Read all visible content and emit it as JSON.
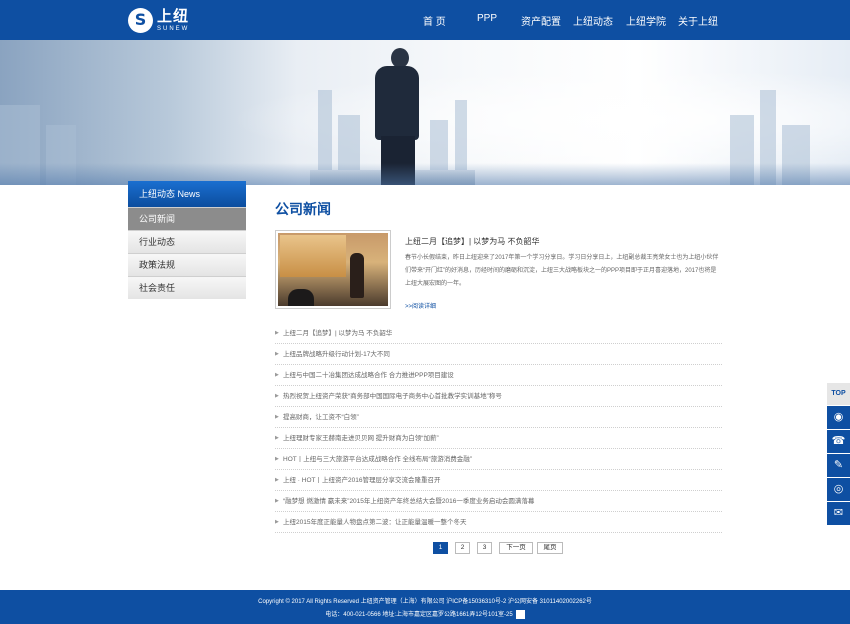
{
  "brand": {
    "name_cn": "上纽",
    "name_en": "SUNEW",
    "logo_letter": "S"
  },
  "nav": {
    "items": [
      {
        "label": "首 页"
      },
      {
        "label": "PPP"
      },
      {
        "label": "资产配置"
      },
      {
        "label": "上纽动态"
      },
      {
        "label": "上纽学院"
      },
      {
        "label": "关于上纽"
      }
    ]
  },
  "sidebar": {
    "header": "上纽动态 News",
    "items": [
      {
        "label": "公司新闻",
        "active": true
      },
      {
        "label": "行业动态"
      },
      {
        "label": "政策法规"
      },
      {
        "label": "社会责任"
      }
    ]
  },
  "content": {
    "title": "公司新闻",
    "feature": {
      "title": "上纽二月【追梦】| 以梦为马 不负韶华",
      "desc": "春节小长假结束，昨日上纽迎来了2017年第一个学习分享日。学习日分享日上，上纽副总裁王亮荣女士也为上纽小伙伴们带来“开门红”的好消息，历经时间的磨砺和沉淀，上纽三大战略板块之一的PPP项目即于正月喜迎落地，2017也将是上纽大展宏图的一年。",
      "more": ">>阅读详细"
    },
    "news": [
      {
        "title": "上纽二月【追梦】| 以梦为马 不负韶华"
      },
      {
        "title": "上纽品牌战略升级行动计划-17大不同"
      },
      {
        "title": "上纽与中国二十冶集团达成战略合作 合力推进PPP项目建设"
      },
      {
        "title": "热烈祝贺上纽资产荣获“商务部中国国际电子商务中心首批教学实训基地”称号"
      },
      {
        "title": "提高财商，让工资不“白领”"
      },
      {
        "title": "上纽理财专家王赫南走进贝贝网 提升财商为白领“加薪”"
      },
      {
        "title": "HOT丨上纽与三大旅游平台达成战略合作 全线布局“旅游消费金融”"
      },
      {
        "title": "上纽 · HOT丨上纽资产2016管理层分享交流会隆重召开"
      },
      {
        "title": "“融梦想 燃激情 赢未来”2015年上纽资产年终总结大会暨2016一季度业务启动会圆满落幕"
      },
      {
        "title": "上纽2015年度正能量人物盘点第二波：让正能量温暖一整个冬天"
      }
    ],
    "bullet": "▶"
  },
  "pagination": {
    "pages": [
      "1",
      "2",
      "3"
    ],
    "current": "1",
    "next": "下一页",
    "last": "尾页"
  },
  "footer": {
    "line1": "Copyright © 2017 All Rights Reserved 上纽资产管理（上海）有限公司 沪ICP备15036310号-2 沪公网安备 31011402002262号",
    "line2": "电话：400-021-0566 地址:上海市嘉定区嘉罗公路1661弄12号101室-25"
  },
  "floatbar": {
    "top_label": "TOP",
    "buttons": [
      "qq-icon",
      "phone-icon",
      "edit-icon",
      "weibo-icon",
      "wechat-icon"
    ]
  },
  "colors": {
    "primary": "#0e4fa2",
    "sidebar_active": "#8c8c8c"
  }
}
